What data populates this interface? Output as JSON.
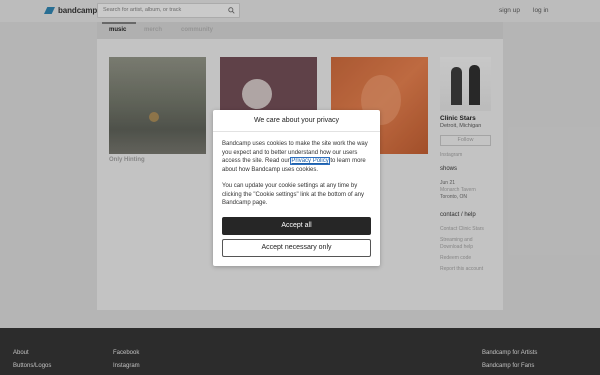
{
  "header": {
    "logo_text": "bandcamp",
    "search_placeholder": "Search for artist, album, or track",
    "signup_label": "sign up",
    "login_label": "log in"
  },
  "tabs": [
    {
      "label": "music",
      "active": true
    },
    {
      "label": "merch",
      "active": false
    },
    {
      "label": "community",
      "active": false
    }
  ],
  "albums": [
    {
      "title": "Only Hinting"
    }
  ],
  "artist": {
    "name": "Clinic Stars",
    "location": "Detroit, Michigan",
    "follow_label": "Follow",
    "instagram_label": "Instagram",
    "shows_heading": "shows",
    "show_date": "Jun 21",
    "show_venue": "Monarch Tavern",
    "show_city": "Toronto, ON",
    "contact_heading": "contact / help",
    "contact_links": [
      "Contact Clinic Stars",
      "Streaming and",
      "Download help",
      "Redeem code",
      "Report this account"
    ]
  },
  "cookie_dialog": {
    "title": "We care about your privacy",
    "p1_before": "Bandcamp uses cookies to make the site work the way you expect and to better understand how our users access the site. Read our ",
    "p1_link": "Privacy Policy",
    "p1_after": " to learn more about how Bandcamp uses cookies.",
    "p2": "You can update your cookie settings at any time by clicking the \"Cookie settings\" link at the bottom of any Bandcamp page.",
    "accept_all_label": "Accept all",
    "accept_necessary_label": "Accept necessary only"
  },
  "footer": {
    "col1": [
      "About",
      "Buttons/Logos"
    ],
    "col2": [
      "Facebook",
      "Instagram"
    ],
    "col3": [
      "Bandcamp for Artists",
      "Bandcamp for Fans"
    ]
  },
  "colors": {
    "accent": "#2e7ea8",
    "primary_button": "#262626",
    "footer_bg": "#333333"
  }
}
